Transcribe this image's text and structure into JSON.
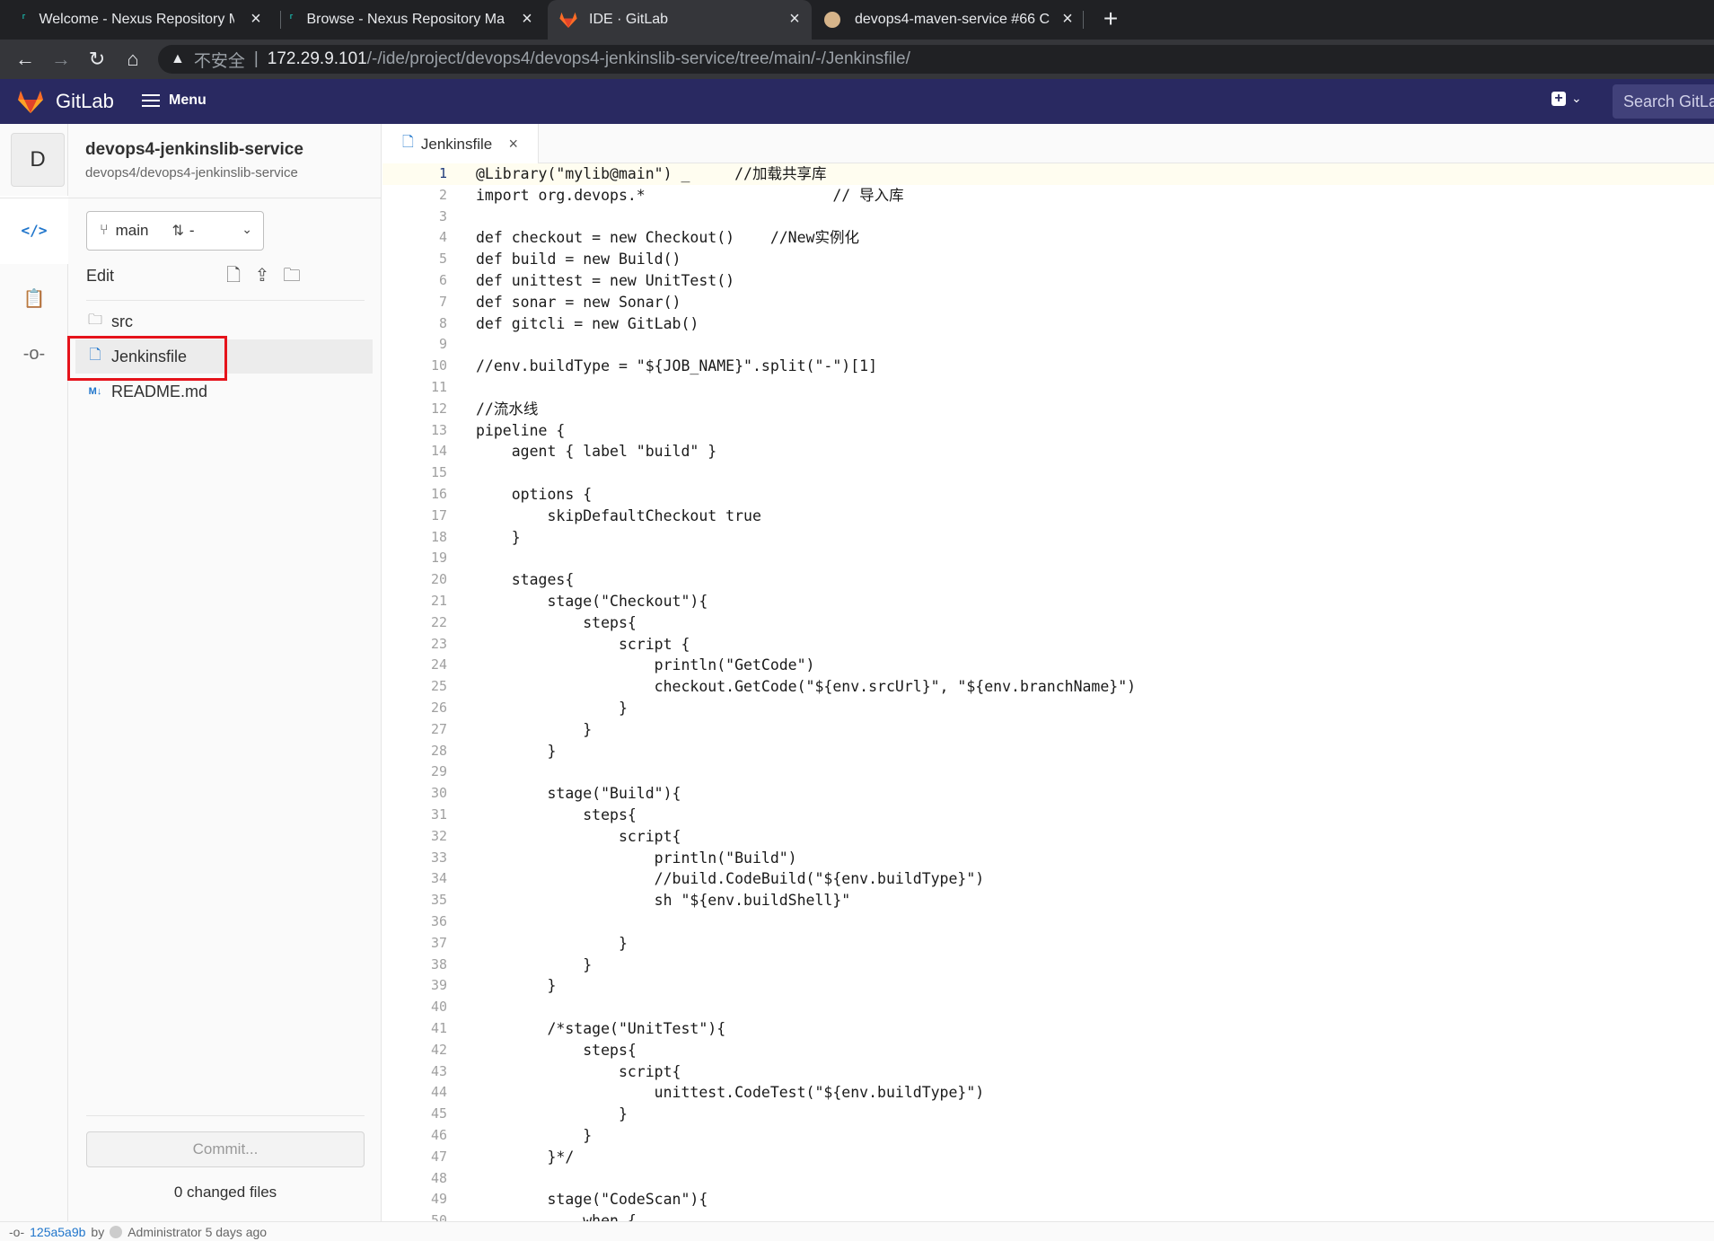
{
  "browser": {
    "tabs": [
      {
        "title": "Welcome - Nexus Repository M",
        "icon": "nexus-icon",
        "active": false
      },
      {
        "title": "Browse - Nexus Repository Ma",
        "icon": "nexus-icon",
        "active": false
      },
      {
        "title": "IDE · GitLab",
        "icon": "gitlab-icon",
        "active": true
      },
      {
        "title": "devops4-maven-service #66 C",
        "icon": "jenkins-icon",
        "active": false
      }
    ],
    "address": {
      "security_label": "不安全",
      "host": "172.29.9.101",
      "path": "/-/ide/project/devops4/devops4-jenkinslib-service/tree/main/-/Jenkinsfile/"
    }
  },
  "header": {
    "brand": "GitLab",
    "menu_label": "Menu",
    "search_placeholder": "Search GitLab",
    "colors": {
      "header_bg": "#292961",
      "logo_orange": "#fc6d26"
    }
  },
  "project": {
    "avatar_letter": "D",
    "name": "devops4-jenkinslib-service",
    "path": "devops4/devops4-jenkinslib-service",
    "branch": "main",
    "merge_request": "-",
    "edit_label": "Edit"
  },
  "file_tree": {
    "items": [
      {
        "name": "src",
        "type": "folder"
      },
      {
        "name": "Jenkinsfile",
        "type": "file",
        "selected": true
      },
      {
        "name": "README.md",
        "type": "markdown"
      }
    ]
  },
  "commit": {
    "button_label": "Commit...",
    "changed_files": "0 changed files"
  },
  "editor": {
    "tab_label": "Jenkinsfile",
    "current_line": 1,
    "lines": [
      "@Library(\"mylib@main\") _     //加载共享库",
      "import org.devops.*                     // 导入库",
      "",
      "def checkout = new Checkout()    //New实例化",
      "def build = new Build()",
      "def unittest = new UnitTest()",
      "def sonar = new Sonar()",
      "def gitcli = new GitLab()",
      "",
      "//env.buildType = \"${JOB_NAME}\".split(\"-\")[1]",
      "",
      "//流水线",
      "pipeline {",
      "    agent { label \"build\" }",
      "",
      "    options {",
      "        skipDefaultCheckout true",
      "    }",
      "",
      "    stages{",
      "        stage(\"Checkout\"){",
      "            steps{",
      "                script {",
      "                    println(\"GetCode\")",
      "                    checkout.GetCode(\"${env.srcUrl}\", \"${env.branchName}\")",
      "                }",
      "            }",
      "        }",
      "",
      "        stage(\"Build\"){",
      "            steps{",
      "                script{",
      "                    println(\"Build\")",
      "                    //build.CodeBuild(\"${env.buildType}\")",
      "                    sh \"${env.buildShell}\"",
      "",
      "                }",
      "            }",
      "        }",
      "",
      "        /*stage(\"UnitTest\"){",
      "            steps{",
      "                script{",
      "                    unittest.CodeTest(\"${env.buildType}\")",
      "                }",
      "            }",
      "        }*/",
      "",
      "        stage(\"CodeScan\"){",
      "            when {"
    ]
  },
  "status_bar": {
    "commit_sha": "125a5a9b",
    "by_label": "by",
    "author_text": "Administrator 5 days ago"
  }
}
